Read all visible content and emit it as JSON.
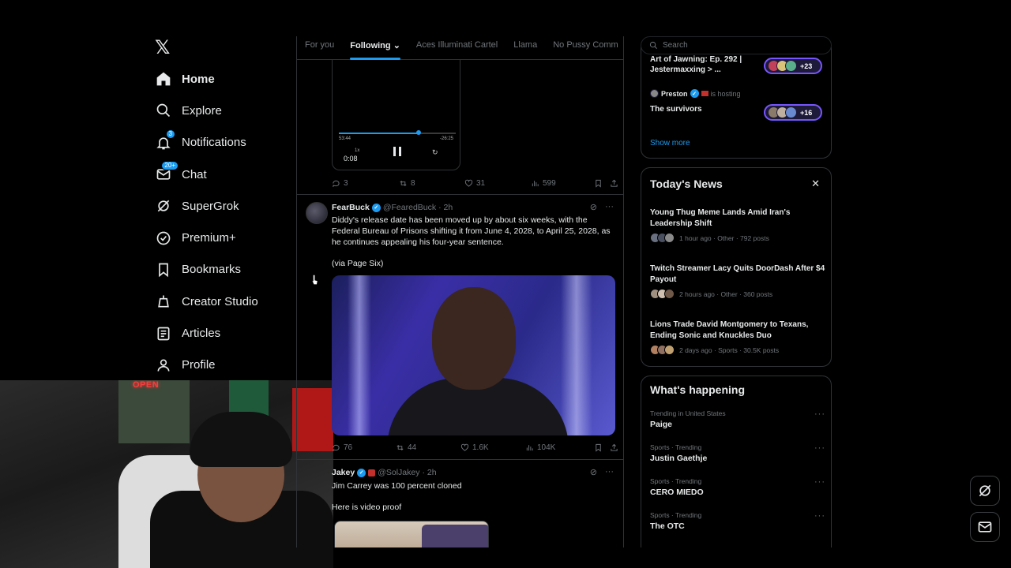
{
  "nav": {
    "logo": "𝕏",
    "items": [
      {
        "label": "Home",
        "icon": "home-icon",
        "active": true
      },
      {
        "label": "Explore",
        "icon": "search-icon"
      },
      {
        "label": "Notifications",
        "icon": "bell-icon",
        "badge": "3"
      },
      {
        "label": "Chat",
        "icon": "mail-icon",
        "badge": "20+"
      },
      {
        "label": "SuperGrok",
        "icon": "grok-icon"
      },
      {
        "label": "Premium+",
        "icon": "premium-icon"
      },
      {
        "label": "Bookmarks",
        "icon": "bookmark-icon"
      },
      {
        "label": "Creator Studio",
        "icon": "creator-studio-icon"
      },
      {
        "label": "Articles",
        "icon": "articles-icon"
      },
      {
        "label": "Profile",
        "icon": "profile-icon"
      }
    ]
  },
  "webcam": {
    "sign": "OPEN"
  },
  "tabs": [
    "For you",
    "Following",
    "Aces Illuminati Cartel",
    "Llama",
    "No Pussy Comm"
  ],
  "media_player": {
    "elapsed": "53:44",
    "remaining": "-26:25",
    "position": "0:08",
    "speed": "1x",
    "progress": 0.68
  },
  "tweet0_actions": {
    "replies": "3",
    "reposts": "8",
    "likes": "31",
    "views": "599"
  },
  "tweet1": {
    "name": "FearBuck",
    "handle": "@FearedBuck",
    "time": "· 2h",
    "text": "Diddy's release date has been moved up by about six weeks, with the Federal Bureau of Prisons shifting it from June 4, 2028, to April 25, 2028, as he continues appealing his four-year sentence.",
    "source": "(via Page Six)",
    "actions": {
      "replies": "76",
      "reposts": "44",
      "likes": "1.6K",
      "views": "104K"
    }
  },
  "tweet2": {
    "name": "Jakey",
    "handle": "@SolJakey",
    "time": "· 2h",
    "text1": "Jim Carrey was 100 percent cloned",
    "text2": "Here is video proof"
  },
  "search": {
    "placeholder": "Search"
  },
  "spaces": {
    "item1": {
      "title": "Art of Jawning: Ep. 292 | Jestermaxxing > ...",
      "count": "+23"
    },
    "item2": {
      "host": "Preston",
      "hosting": "is hosting",
      "title": "The survivors",
      "count": "+16"
    },
    "show_more": "Show more"
  },
  "news": {
    "title": "Today's News",
    "items": [
      {
        "title": "Young Thug Meme Lands Amid Iran's Leadership Shift",
        "meta": "1 hour ago · Other · 792 posts"
      },
      {
        "title": "Twitch Streamer Lacy Quits DoorDash After $4 Payout",
        "meta": "2 hours ago · Other · 360 posts"
      },
      {
        "title": "Lions Trade David Montgomery to Texans, Ending Sonic and Knuckles Duo",
        "meta": "2 days ago · Sports · 30.5K posts"
      }
    ]
  },
  "happening": {
    "title": "What's happening",
    "items": [
      {
        "category": "Trending in United States",
        "name": "Paige"
      },
      {
        "category": "Sports · Trending",
        "name": "Justin Gaethje"
      },
      {
        "category": "Sports · Trending",
        "name": "CERO MIEDO"
      },
      {
        "category": "Sports · Trending",
        "name": "The OTC"
      }
    ]
  },
  "colors": {
    "accent": "#1d9bf0",
    "background": "#000000",
    "border": "#2f3336",
    "muted": "#71767b",
    "spaces_purple": "#7856ff"
  }
}
